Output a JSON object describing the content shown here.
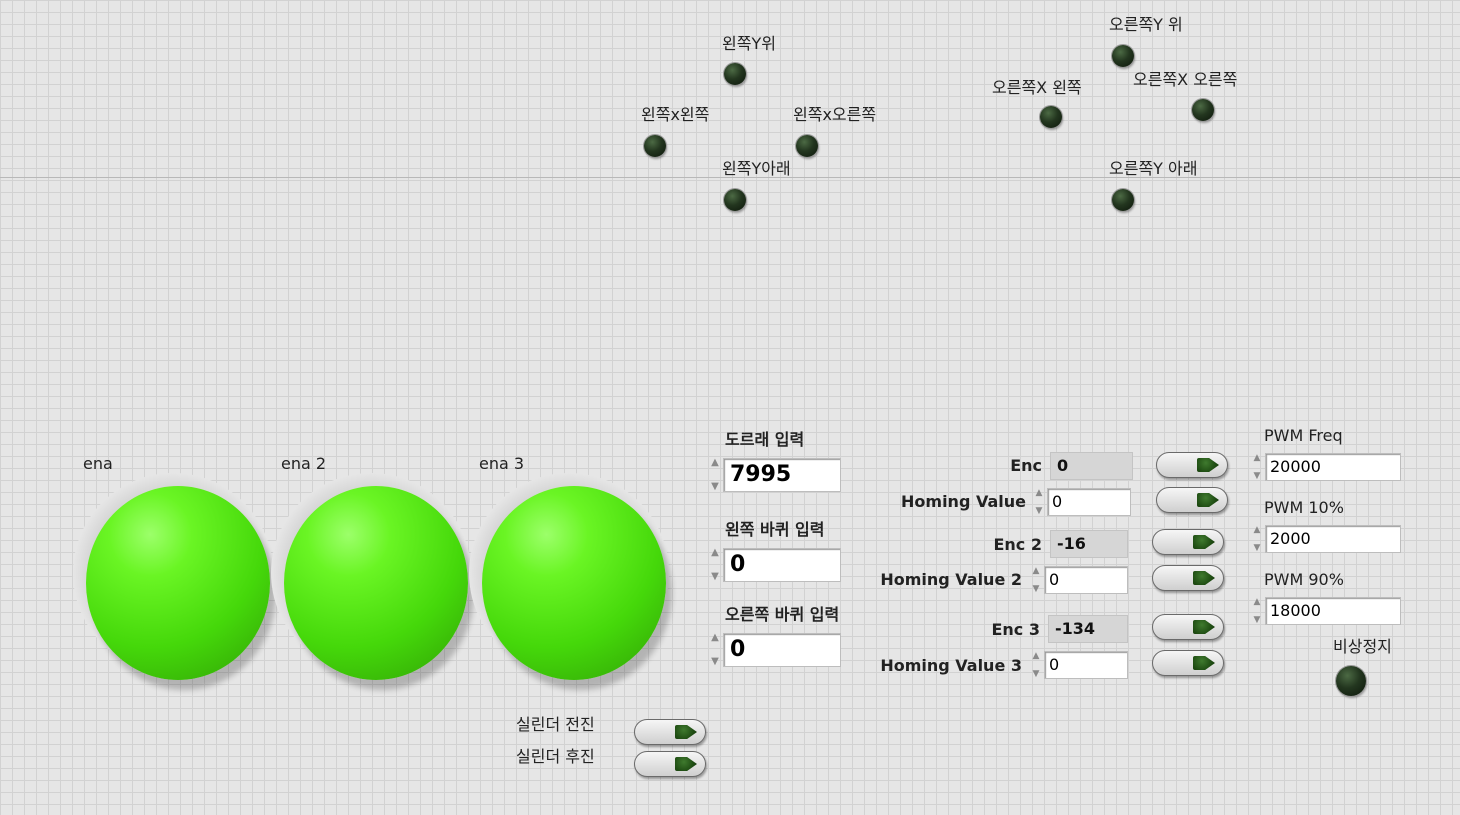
{
  "direction_leds": {
    "left_y_up": "왼쪽Y위",
    "left_x_left": "왼쪽x왼쪽",
    "left_x_right": "왼쪽x오른쪽",
    "left_y_down": "왼쪽Y아래",
    "right_y_up": "오른쪽Y 위",
    "right_x_left": "오른쪽X 왼쪽",
    "right_x_right": "오른쪽X 오른쪽",
    "right_y_down": "오른쪽Y 아래"
  },
  "enable_leds": [
    {
      "label": "ena",
      "state": "on"
    },
    {
      "label": "ena 2",
      "state": "on"
    },
    {
      "label": "ena 3",
      "state": "on"
    }
  ],
  "inputs": {
    "drum": {
      "label": "도르래 입력",
      "value": "7995"
    },
    "left_wheel": {
      "label": "왼쪽 바퀴 입력",
      "value": "0"
    },
    "right_wheel": {
      "label": "오른쪽 바퀴 입력",
      "value": "0"
    }
  },
  "cylinder": {
    "forward": "실린더 전진",
    "backward": "실린더 후진"
  },
  "encoders": [
    {
      "enc_label": "Enc",
      "enc_value": "0",
      "homing_label": "Homing Value",
      "homing_value": "0"
    },
    {
      "enc_label": "Enc 2",
      "enc_value": "-16",
      "homing_label": "Homing Value 2",
      "homing_value": "0"
    },
    {
      "enc_label": "Enc 3",
      "enc_value": "-134",
      "homing_label": "Homing Value 3",
      "homing_value": "0"
    }
  ],
  "pwm": {
    "freq": {
      "label": "PWM Freq",
      "value": "20000"
    },
    "p10": {
      "label": "PWM 10%",
      "value": "2000"
    },
    "p90": {
      "label": "PWM 90%",
      "value": "18000"
    }
  },
  "estop": {
    "label": "비상정지"
  },
  "colors": {
    "background": "#e6e6e6",
    "led_on_green": "#45d80a",
    "led_off_dark": "#23361f"
  },
  "icons": {
    "spin_up": "▲",
    "spin_down": "▼"
  }
}
